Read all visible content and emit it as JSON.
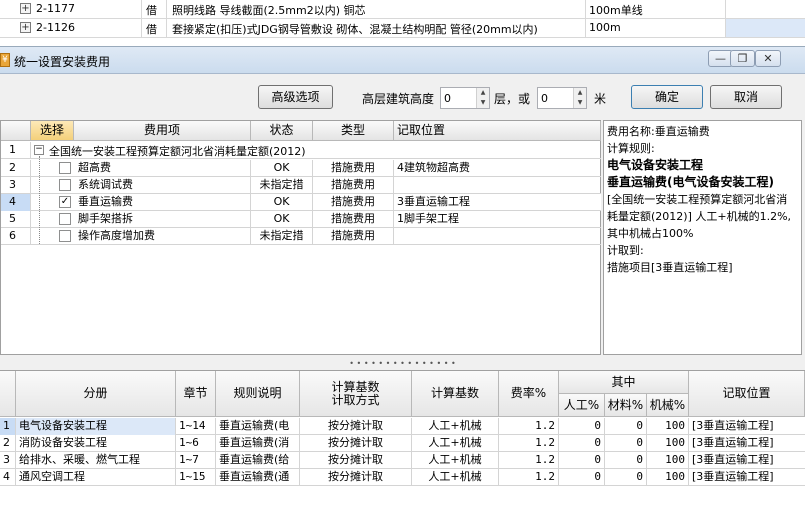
{
  "background_rows": [
    {
      "code": "2-1177",
      "type": "借",
      "name": "照明线路 导线截面(2.5mm2以内) 铜芯",
      "unit": "100m单线"
    },
    {
      "code": "2-1126",
      "type": "借",
      "name": "套接紧定(扣压)式JDG钢导管敷设 砌体、混凝土结构明配 管径(20mm以内)",
      "unit": "100m"
    }
  ],
  "dialog": {
    "title": "统一设置安装费用",
    "advanced_button": "高级选项",
    "height_label": "高层建筑高度",
    "floors_value": "0",
    "floors_unit": "层，或",
    "meters_value": "0",
    "meters_unit": "米",
    "ok_button": "确定",
    "cancel_button": "取消"
  },
  "tree": {
    "headers": [
      "选择",
      "费用项",
      "状态",
      "类型",
      "记取位置"
    ],
    "root": {
      "index": "1",
      "label": "全国统一安装工程预算定额河北省消耗量定额(2012)"
    },
    "rows": [
      {
        "index": "2",
        "checked": false,
        "name": "超高费",
        "status": "OK",
        "type": "措施费用",
        "position": "4建筑物超高费"
      },
      {
        "index": "3",
        "checked": false,
        "name": "系统调试费",
        "status": "未指定措",
        "type": "措施费用",
        "position": ""
      },
      {
        "index": "4",
        "checked": true,
        "name": "垂直运输费",
        "status": "OK",
        "type": "措施费用",
        "position": "3垂直运输工程"
      },
      {
        "index": "5",
        "checked": false,
        "name": "脚手架搭拆",
        "status": "OK",
        "type": "措施费用",
        "position": "1脚手架工程"
      },
      {
        "index": "6",
        "checked": false,
        "name": "操作高度增加费",
        "status": "未指定措",
        "type": "措施费用",
        "position": ""
      }
    ]
  },
  "info": {
    "line1": "费用名称:垂直运输费",
    "line2": "计算规则:",
    "line3": "电气设备安装工程",
    "line4": "垂直运输费(电气设备安装工程)",
    "line5": "[全国统一安装工程预算定额河北省消耗量定额(2012)] 人工+机械的1.2%, 其中机械占100%",
    "line6": "计取到:",
    "line7": "措施项目[3垂直运输工程]"
  },
  "grid": {
    "headers": {
      "category": "分册",
      "chapter": "章节",
      "rule": "规则说明",
      "method": "计算基数\n计取方式",
      "base": "计算基数",
      "rate": "费率%",
      "of_which": "其中",
      "labor": "人工%",
      "material": "材料%",
      "machine": "机械%",
      "position": "记取位置"
    },
    "rows": [
      {
        "index": "1",
        "category": "电气设备安装工程",
        "chapter": "1~14",
        "rule": "垂直运输费(电",
        "method": "按分摊计取",
        "base": "人工+机械",
        "rate": "1.2",
        "labor": "0",
        "material": "0",
        "machine": "100",
        "position": "[3垂直运输工程]"
      },
      {
        "index": "2",
        "category": "消防设备安装工程",
        "chapter": "1~6",
        "rule": "垂直运输费(消",
        "method": "按分摊计取",
        "base": "人工+机械",
        "rate": "1.2",
        "labor": "0",
        "material": "0",
        "machine": "100",
        "position": "[3垂直运输工程]"
      },
      {
        "index": "3",
        "category": "给排水、采暖、燃气工程",
        "chapter": "1~7",
        "rule": "垂直运输费(给",
        "method": "按分摊计取",
        "base": "人工+机械",
        "rate": "1.2",
        "labor": "0",
        "material": "0",
        "machine": "100",
        "position": "[3垂直运输工程]"
      },
      {
        "index": "4",
        "category": "通风空调工程",
        "chapter": "1~15",
        "rule": "垂直运输费(通",
        "method": "按分摊计取",
        "base": "人工+机械",
        "rate": "1.2",
        "labor": "0",
        "material": "0",
        "machine": "100",
        "position": "[3垂直运输工程]"
      }
    ]
  }
}
